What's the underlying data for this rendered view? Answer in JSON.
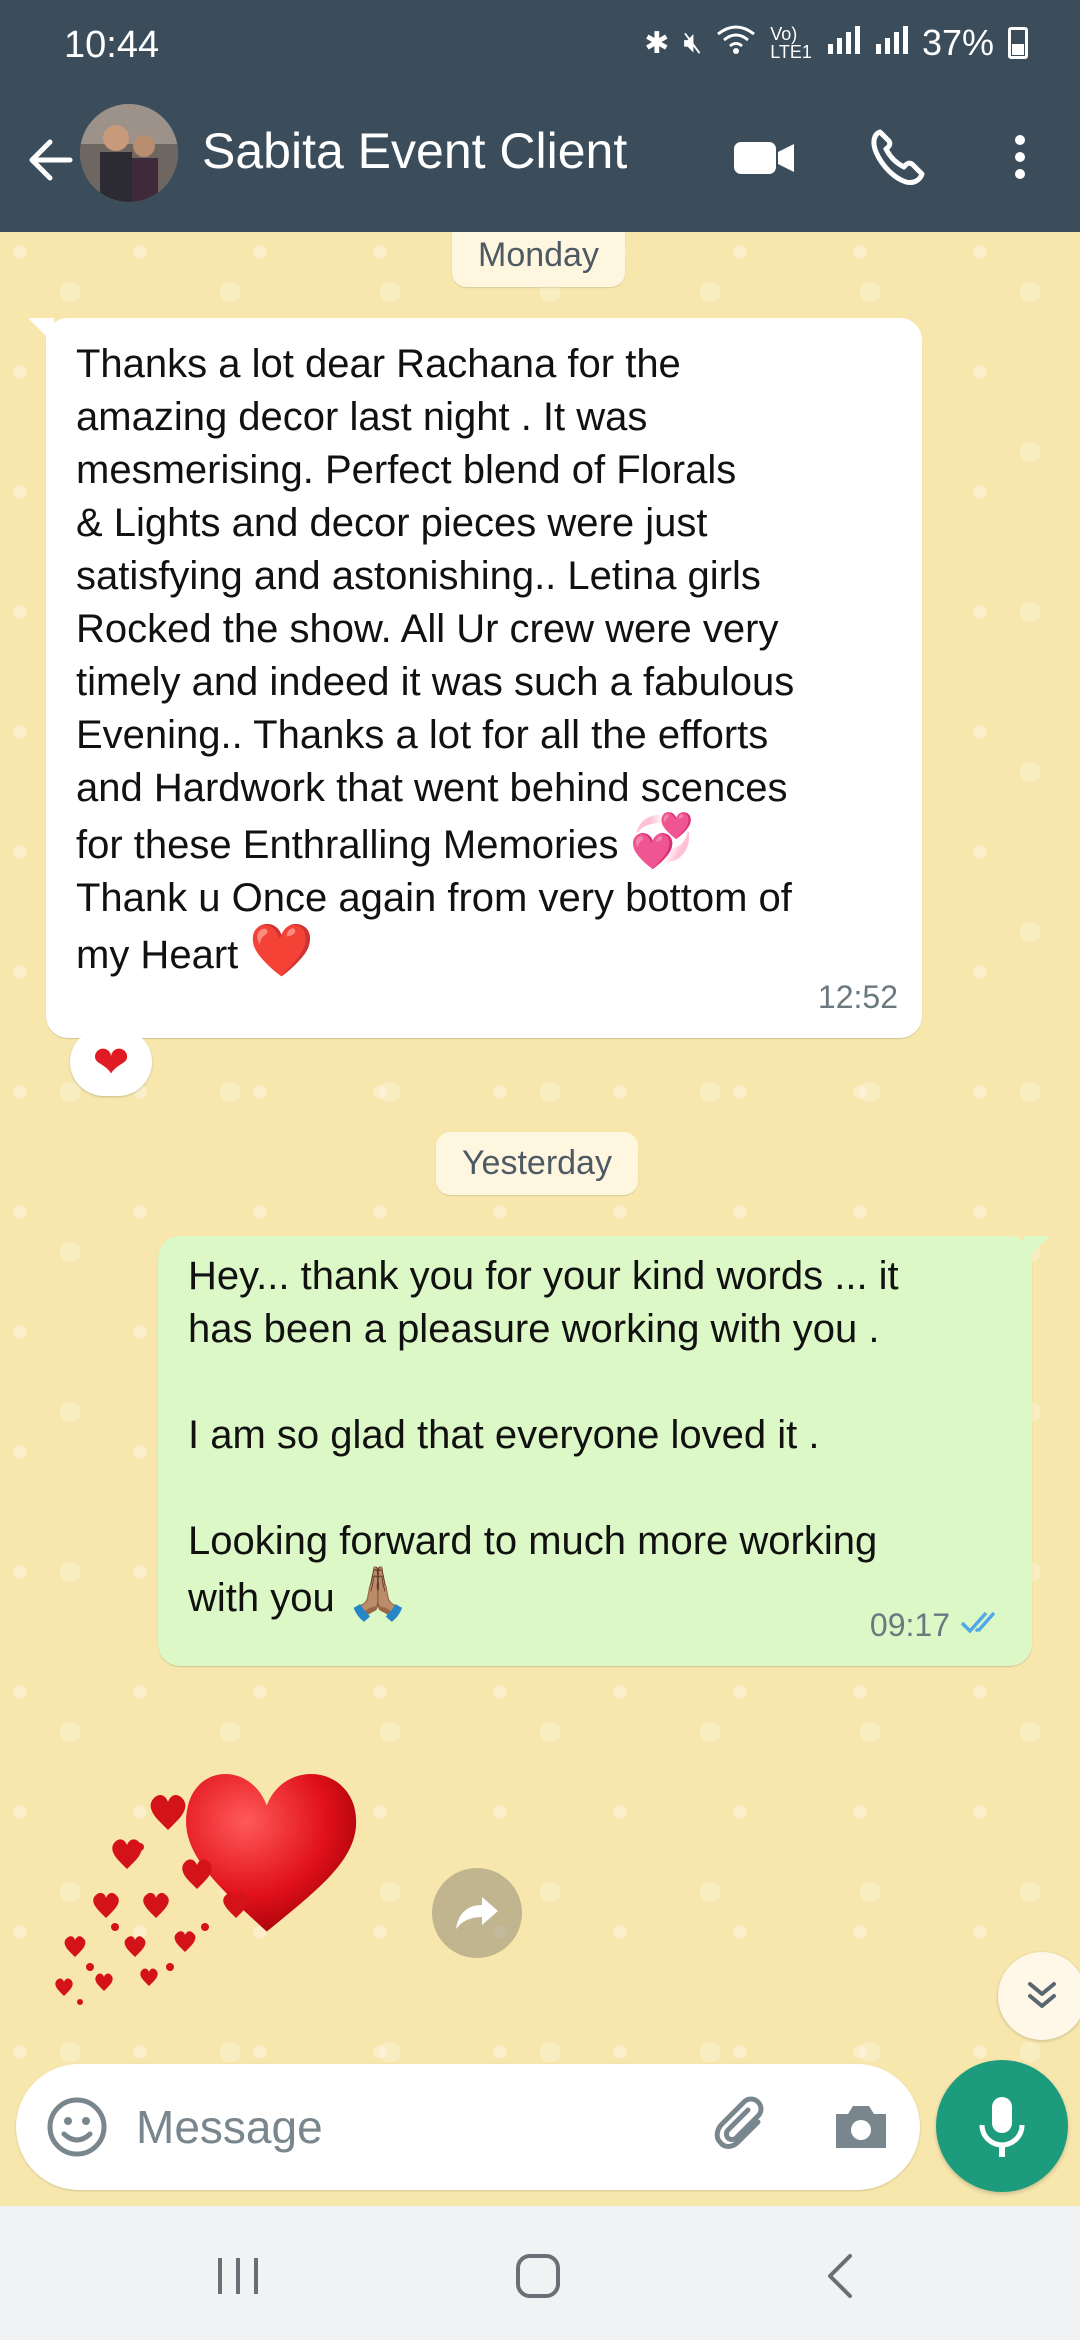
{
  "status_bar": {
    "time": "10:44",
    "battery": "37%",
    "icons": [
      "bluetooth-icon",
      "mute-icon",
      "wifi-icon",
      "volte-icon",
      "signal-icon",
      "signal-icon",
      "battery-icon"
    ]
  },
  "header": {
    "contact_name": "Sabita Event Client",
    "icons": [
      "back-arrow-icon",
      "video-call-icon",
      "phone-call-icon",
      "more-options-icon"
    ]
  },
  "chat": {
    "date_chips": [
      "Monday",
      "Yesterday"
    ],
    "incoming": {
      "text_main": "Thanks a lot dear Rachana for the\namazing decor last night . It was\nmesmerising. Perfect blend of Florals\n& Lights and decor pieces were just\nsatisfying and astonishing.. Letina girls\nRocked the show. All Ur crew were very\ntimely and indeed it was such a fabulous\nEvening.. Thanks a lot for all the efforts\nand Hardwork that went behind scences\nfor these Enthralling Memories ",
      "emoji_1": "💞",
      "text_2": "\nThank u Once again from very bottom of\nmy Heart ",
      "emoji_2": "❤️",
      "time": "12:52",
      "reaction": "❤"
    },
    "outgoing": {
      "text": "Hey... thank you for your kind words ... it\nhas been a pleasure working with you .\n\nI am so glad that everyone loved it .\n\nLooking forward to much more working\nwith you ",
      "emoji": "🙏🏽",
      "time": "09:17",
      "status": "read"
    },
    "sticker": "heart-sticker",
    "colors": {
      "wallpaper": "#f7e7ad",
      "outgoing_bubble": "#dcf8c6",
      "header": "#3b4d5a",
      "accent": "#1c9c7c",
      "read_ticks": "#4fa9e8"
    }
  },
  "input": {
    "placeholder": "Message",
    "value": ""
  }
}
